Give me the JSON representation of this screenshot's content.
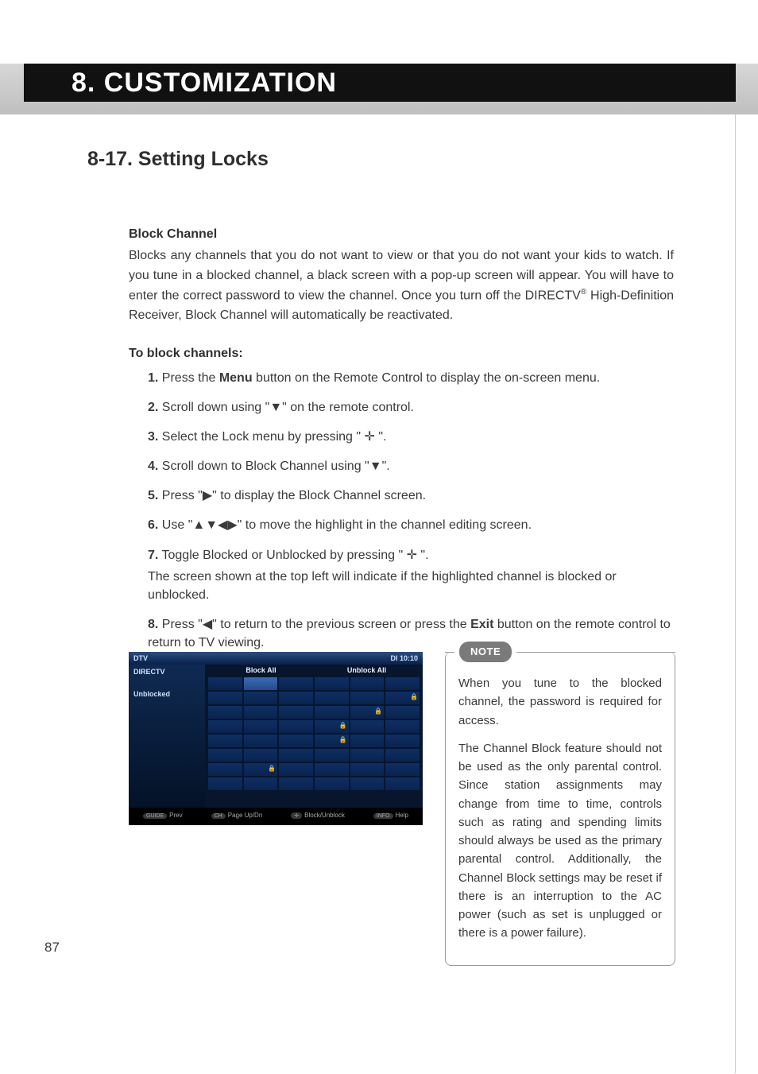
{
  "header": {
    "chapter": "8. CUSTOMIZATION"
  },
  "section": {
    "title": "8-17. Setting Locks"
  },
  "block_channel": {
    "heading": "Block Channel",
    "para_pre": "Blocks any channels that you do not want to view or that you do not want your kids to watch. If you tune in a blocked channel, a black screen with a pop-up screen will appear.  You will have to enter the correct password to view the channel.  Once you turn off the DIRECTV",
    "reg": "®",
    "para_post": " High-Definition Receiver, Block Channel will automatically be reactivated."
  },
  "to_block": {
    "heading": "To block channels:"
  },
  "steps": [
    {
      "n": "1.",
      "pre": " Press the ",
      "bold": "Menu",
      "post": " button on the Remote Control to display the on-screen menu."
    },
    {
      "n": "2.",
      "pre": " Scroll down using \"",
      "glyph": "▼",
      "post": "\" on the remote control."
    },
    {
      "n": "3.",
      "pre": " Select the Lock menu by pressing \" ",
      "glyph": "✛",
      "post": " \"."
    },
    {
      "n": "4.",
      "pre": " Scroll down to Block Channel using \"",
      "glyph": "▼",
      "post": "\"."
    },
    {
      "n": "5.",
      "pre": " Press \"",
      "glyph": "▶",
      "post": "\" to display the Block Channel screen."
    },
    {
      "n": "6.",
      "pre": " Use \"",
      "glyph": "▲▼◀▶",
      "post": "\" to move the highlight in the channel editing screen."
    },
    {
      "n": "7.",
      "pre": " Toggle Blocked or Unblocked by pressing \" ",
      "glyph": "✛",
      "post": " \".",
      "sub": "The screen shown at the top left will indicate if the highlighted channel is blocked or unblocked."
    },
    {
      "n": "8.",
      "pre": " Press \"",
      "glyph": "◀",
      "post_pre": "\" to return to the previous screen or press the ",
      "bold": "Exit",
      "post": " button on the remote control to return to TV viewing."
    }
  ],
  "screenshot": {
    "brand": "DTV",
    "clock": "DI  10:10",
    "provider": "DIRECTV",
    "status": "Unblocked",
    "head_left": "Block All",
    "head_right": "Unblock All",
    "foot": {
      "prev": "Prev",
      "page": "Page Up/Dn",
      "block": "Block/Unblock",
      "help": "Help"
    },
    "foot_icons": {
      "prev": "GUIDE",
      "page": "CH",
      "block": "✛",
      "help": "INFO"
    }
  },
  "note": {
    "label": "NOTE",
    "p1": "When you tune to the blocked channel, the password is required for access.",
    "p2": "The Channel Block feature should not be used as the only parental control. Since station assignments may change from time to time, controls such as rating and spending limits should always be used as the primary parental control. Additionally, the Channel Block settings may be reset if there is an interruption to the AC power (such as set is unplugged or there is a power failure)."
  },
  "page_number": "87"
}
